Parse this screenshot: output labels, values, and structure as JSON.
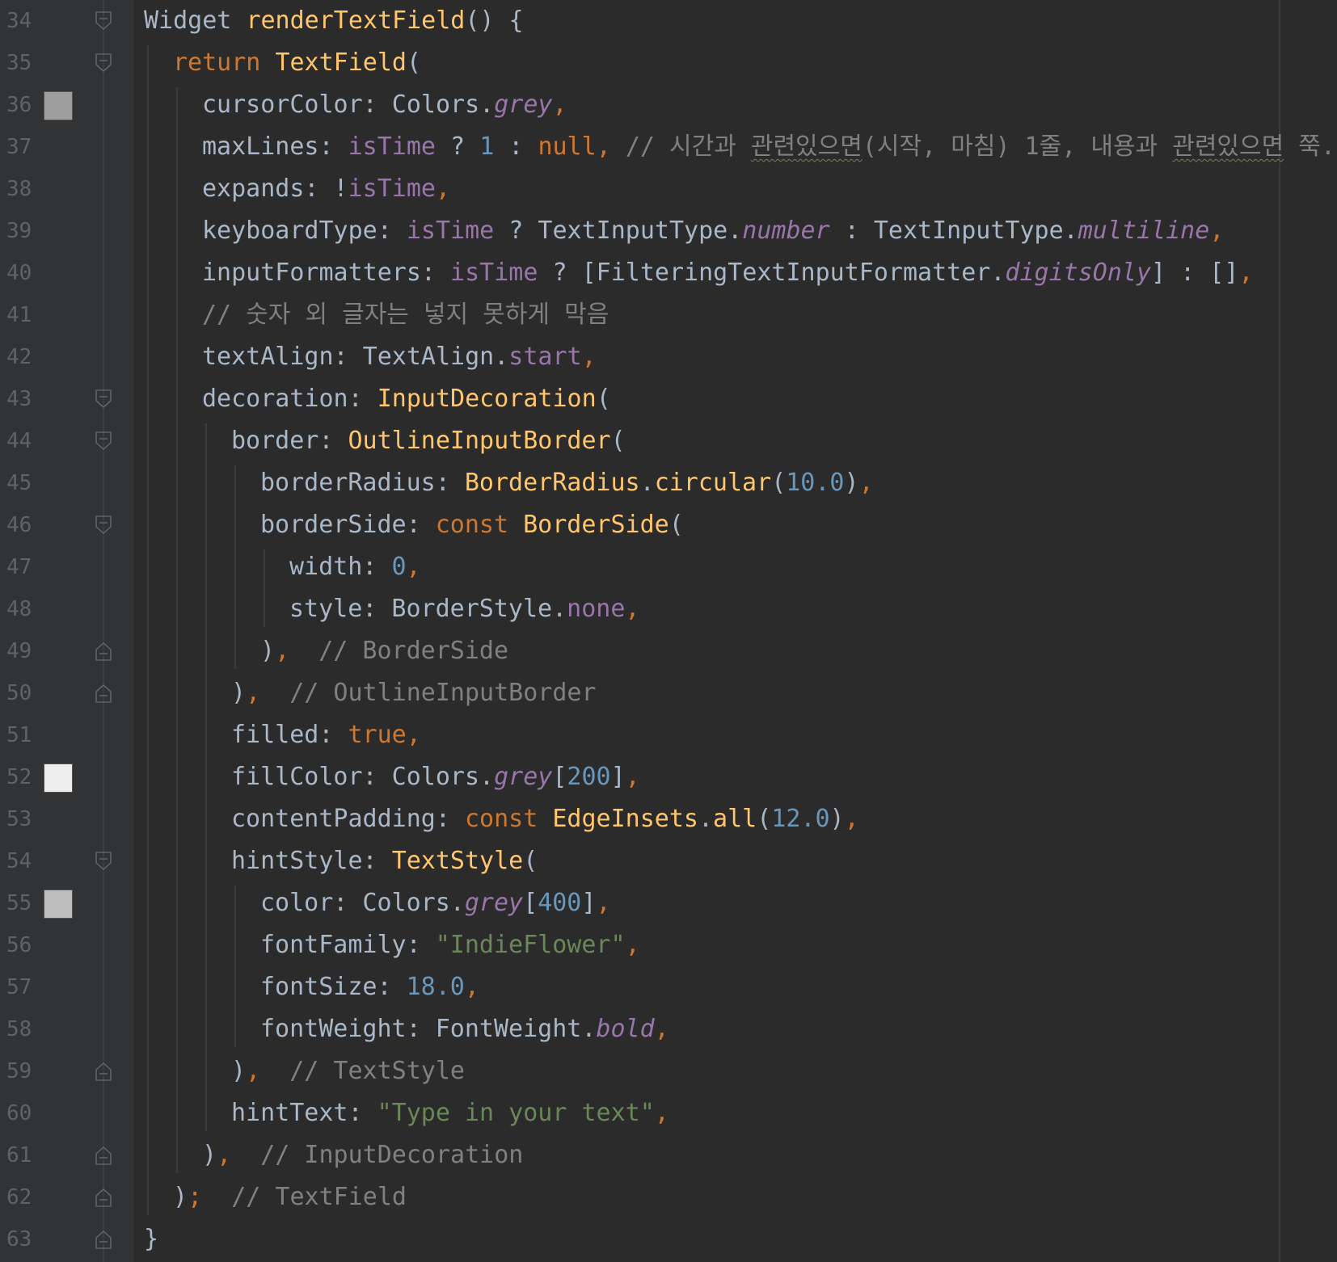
{
  "editor": {
    "colors": {
      "background": "#2b2b2b",
      "gutter": "#313335",
      "keyword": "#cc7832",
      "function": "#ffc66d",
      "property": "#9876aa",
      "number": "#6897bb",
      "string": "#6a8759",
      "comment": "#808080",
      "default": "#a9b7c6"
    },
    "lines": [
      {
        "number": "34",
        "indent": 0,
        "fold": "open",
        "tokens": [
          {
            "t": "Widget ",
            "c": "op"
          },
          {
            "t": "renderTextField",
            "c": "fn"
          },
          {
            "t": "() {",
            "c": "op"
          }
        ]
      },
      {
        "number": "35",
        "indent": 1,
        "fold": "open",
        "tokens": [
          {
            "t": "return ",
            "c": "kw"
          },
          {
            "t": "TextField",
            "c": "fn"
          },
          {
            "t": "(",
            "c": "op"
          }
        ]
      },
      {
        "number": "36",
        "indent": 2,
        "swatch": "#9e9e9e",
        "tokens": [
          {
            "t": "cursorColor: Colors.",
            "c": "op"
          },
          {
            "t": "grey",
            "c": "it"
          },
          {
            "t": ",",
            "c": "kw"
          }
        ]
      },
      {
        "number": "37",
        "indent": 2,
        "tokens": [
          {
            "t": "maxLines: ",
            "c": "op"
          },
          {
            "t": "isTime",
            "c": "pm"
          },
          {
            "t": " ? ",
            "c": "op"
          },
          {
            "t": "1",
            "c": "num"
          },
          {
            "t": " : ",
            "c": "op"
          },
          {
            "t": "null",
            "c": "kw"
          },
          {
            "t": ", ",
            "c": "kw"
          },
          {
            "t": "// 시간과 ",
            "c": "cm"
          },
          {
            "t": "관련있으면",
            "c": "cm",
            "squig": true
          },
          {
            "t": "(시작, 마침) 1줄, 내용과 ",
            "c": "cm"
          },
          {
            "t": "관련있으면",
            "c": "cm",
            "squig": true
          },
          {
            "t": " 쭉..",
            "c": "cm"
          }
        ]
      },
      {
        "number": "38",
        "indent": 2,
        "tokens": [
          {
            "t": "expands: !",
            "c": "op"
          },
          {
            "t": "isTime",
            "c": "pm"
          },
          {
            "t": ",",
            "c": "kw"
          }
        ]
      },
      {
        "number": "39",
        "indent": 2,
        "tokens": [
          {
            "t": "keyboardType: ",
            "c": "op"
          },
          {
            "t": "isTime",
            "c": "pm"
          },
          {
            "t": " ? TextInputType.",
            "c": "op"
          },
          {
            "t": "number",
            "c": "it"
          },
          {
            "t": " : TextInputType.",
            "c": "op"
          },
          {
            "t": "multiline",
            "c": "it"
          },
          {
            "t": ",",
            "c": "kw"
          }
        ]
      },
      {
        "number": "40",
        "indent": 2,
        "tokens": [
          {
            "t": "inputFormatters: ",
            "c": "op"
          },
          {
            "t": "isTime",
            "c": "pm"
          },
          {
            "t": " ? [FilteringTextInputFormatter.",
            "c": "op"
          },
          {
            "t": "digitsOnly",
            "c": "it"
          },
          {
            "t": "] : []",
            "c": "op"
          },
          {
            "t": ",",
            "c": "kw"
          }
        ]
      },
      {
        "number": "41",
        "indent": 2,
        "tokens": [
          {
            "t": "// 숫자 외 글자는 넣지 못하게 막음",
            "c": "cm"
          }
        ]
      },
      {
        "number": "42",
        "indent": 2,
        "tokens": [
          {
            "t": "textAlign: TextAlign.",
            "c": "op"
          },
          {
            "t": "start",
            "c": "pm"
          },
          {
            "t": ",",
            "c": "kw"
          }
        ]
      },
      {
        "number": "43",
        "indent": 2,
        "fold": "open",
        "tokens": [
          {
            "t": "decoration: ",
            "c": "op"
          },
          {
            "t": "InputDecoration",
            "c": "fn"
          },
          {
            "t": "(",
            "c": "op"
          }
        ]
      },
      {
        "number": "44",
        "indent": 3,
        "fold": "open",
        "tokens": [
          {
            "t": "border: ",
            "c": "op"
          },
          {
            "t": "OutlineInputBorder",
            "c": "fn"
          },
          {
            "t": "(",
            "c": "op"
          }
        ]
      },
      {
        "number": "45",
        "indent": 4,
        "tokens": [
          {
            "t": "borderRadius: ",
            "c": "op"
          },
          {
            "t": "BorderRadius",
            "c": "fn"
          },
          {
            "t": ".",
            "c": "op"
          },
          {
            "t": "circular",
            "c": "fn"
          },
          {
            "t": "(",
            "c": "op"
          },
          {
            "t": "10.0",
            "c": "num"
          },
          {
            "t": ")",
            "c": "op"
          },
          {
            "t": ",",
            "c": "kw"
          }
        ]
      },
      {
        "number": "46",
        "indent": 4,
        "fold": "open",
        "tokens": [
          {
            "t": "borderSide: ",
            "c": "op"
          },
          {
            "t": "const ",
            "c": "kw"
          },
          {
            "t": "BorderSide",
            "c": "fn"
          },
          {
            "t": "(",
            "c": "op"
          }
        ]
      },
      {
        "number": "47",
        "indent": 5,
        "tokens": [
          {
            "t": "width: ",
            "c": "op"
          },
          {
            "t": "0",
            "c": "num"
          },
          {
            "t": ",",
            "c": "kw"
          }
        ]
      },
      {
        "number": "48",
        "indent": 5,
        "tokens": [
          {
            "t": "style: BorderStyle.",
            "c": "op"
          },
          {
            "t": "none",
            "c": "pm"
          },
          {
            "t": ",",
            "c": "kw"
          }
        ]
      },
      {
        "number": "49",
        "indent": 4,
        "fold": "close",
        "tokens": [
          {
            "t": ")",
            "c": "op"
          },
          {
            "t": ",  ",
            "c": "kw"
          },
          {
            "t": "// BorderSide",
            "c": "cm"
          }
        ]
      },
      {
        "number": "50",
        "indent": 3,
        "fold": "close",
        "tokens": [
          {
            "t": ")",
            "c": "op"
          },
          {
            "t": ",  ",
            "c": "kw"
          },
          {
            "t": "// OutlineInputBorder",
            "c": "cm"
          }
        ]
      },
      {
        "number": "51",
        "indent": 3,
        "tokens": [
          {
            "t": "filled: ",
            "c": "op"
          },
          {
            "t": "true",
            "c": "kw"
          },
          {
            "t": ",",
            "c": "kw"
          }
        ]
      },
      {
        "number": "52",
        "indent": 3,
        "swatch": "#eeeeee",
        "tokens": [
          {
            "t": "fillColor: Colors.",
            "c": "op"
          },
          {
            "t": "grey",
            "c": "it"
          },
          {
            "t": "[",
            "c": "op"
          },
          {
            "t": "200",
            "c": "num"
          },
          {
            "t": "]",
            "c": "op"
          },
          {
            "t": ",",
            "c": "kw"
          }
        ]
      },
      {
        "number": "53",
        "indent": 3,
        "tokens": [
          {
            "t": "contentPadding: ",
            "c": "op"
          },
          {
            "t": "const ",
            "c": "kw"
          },
          {
            "t": "EdgeInsets",
            "c": "fn"
          },
          {
            "t": ".",
            "c": "op"
          },
          {
            "t": "all",
            "c": "fn"
          },
          {
            "t": "(",
            "c": "op"
          },
          {
            "t": "12.0",
            "c": "num"
          },
          {
            "t": ")",
            "c": "op"
          },
          {
            "t": ",",
            "c": "kw"
          }
        ]
      },
      {
        "number": "54",
        "indent": 3,
        "fold": "open",
        "tokens": [
          {
            "t": "hintStyle: ",
            "c": "op"
          },
          {
            "t": "TextStyle",
            "c": "fn"
          },
          {
            "t": "(",
            "c": "op"
          }
        ]
      },
      {
        "number": "55",
        "indent": 4,
        "swatch": "#bdbdbd",
        "tokens": [
          {
            "t": "color: Colors.",
            "c": "op"
          },
          {
            "t": "grey",
            "c": "it"
          },
          {
            "t": "[",
            "c": "op"
          },
          {
            "t": "400",
            "c": "num"
          },
          {
            "t": "]",
            "c": "op"
          },
          {
            "t": ",",
            "c": "kw"
          }
        ]
      },
      {
        "number": "56",
        "indent": 4,
        "tokens": [
          {
            "t": "fontFamily: ",
            "c": "op"
          },
          {
            "t": "\"IndieFlower\"",
            "c": "str"
          },
          {
            "t": ",",
            "c": "kw"
          }
        ]
      },
      {
        "number": "57",
        "indent": 4,
        "tokens": [
          {
            "t": "fontSize: ",
            "c": "op"
          },
          {
            "t": "18.0",
            "c": "num"
          },
          {
            "t": ",",
            "c": "kw"
          }
        ]
      },
      {
        "number": "58",
        "indent": 4,
        "tokens": [
          {
            "t": "fontWeight: FontWeight.",
            "c": "op"
          },
          {
            "t": "bold",
            "c": "it"
          },
          {
            "t": ",",
            "c": "kw"
          }
        ]
      },
      {
        "number": "59",
        "indent": 3,
        "fold": "close",
        "tokens": [
          {
            "t": ")",
            "c": "op"
          },
          {
            "t": ",  ",
            "c": "kw"
          },
          {
            "t": "// TextStyle",
            "c": "cm"
          }
        ]
      },
      {
        "number": "60",
        "indent": 3,
        "tokens": [
          {
            "t": "hintText: ",
            "c": "op"
          },
          {
            "t": "\"Type in your text\"",
            "c": "str"
          },
          {
            "t": ",",
            "c": "kw"
          }
        ]
      },
      {
        "number": "61",
        "indent": 2,
        "fold": "close",
        "tokens": [
          {
            "t": ")",
            "c": "op"
          },
          {
            "t": ",  ",
            "c": "kw"
          },
          {
            "t": "// InputDecoration",
            "c": "cm"
          }
        ]
      },
      {
        "number": "62",
        "indent": 1,
        "fold": "close",
        "tokens": [
          {
            "t": ")",
            "c": "op"
          },
          {
            "t": ";  ",
            "c": "kw"
          },
          {
            "t": "// TextField",
            "c": "cm"
          }
        ]
      },
      {
        "number": "63",
        "indent": 0,
        "fold": "close",
        "tokens": [
          {
            "t": "}",
            "c": "op"
          }
        ]
      }
    ]
  }
}
